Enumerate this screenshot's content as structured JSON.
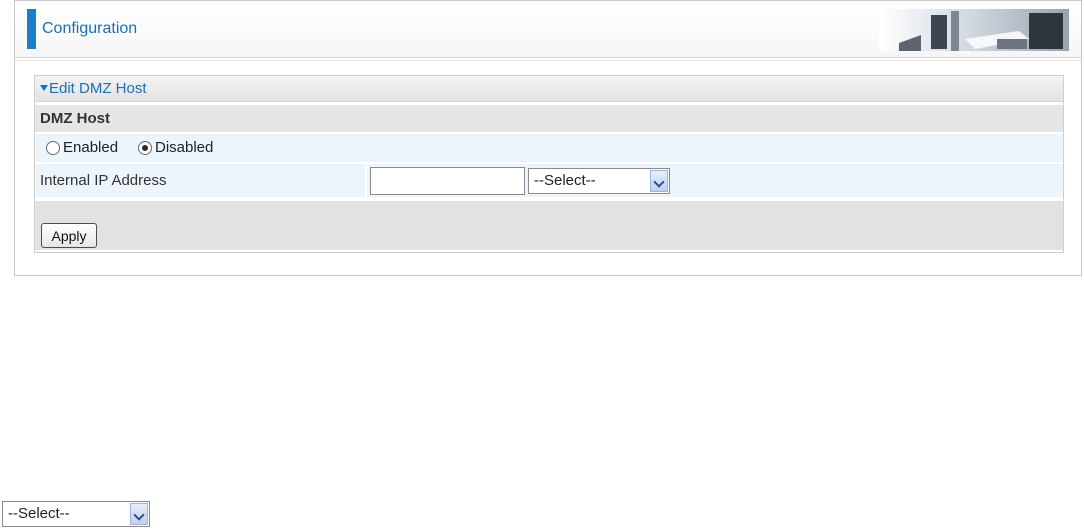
{
  "header": {
    "title": "Configuration"
  },
  "section": {
    "title": "Edit DMZ Host"
  },
  "dmz": {
    "heading": "DMZ Host",
    "options": [
      {
        "label": "Enabled",
        "checked": false
      },
      {
        "label": "Disabled",
        "checked": true
      }
    ]
  },
  "ip": {
    "label": "Internal IP Address",
    "value": "",
    "select_value": "--Select--"
  },
  "apply": {
    "label": "Apply"
  },
  "standalone_select": {
    "value": "--Select--"
  },
  "icons": [
    "chevron-down-icon",
    "triangle-down-icon",
    "office-banner-graphic"
  ],
  "colors": {
    "accent": "#1a7ec8",
    "title": "#1b6fb5",
    "row_blue": "#ecf5fb",
    "row_gray": "#e6e6e6"
  }
}
